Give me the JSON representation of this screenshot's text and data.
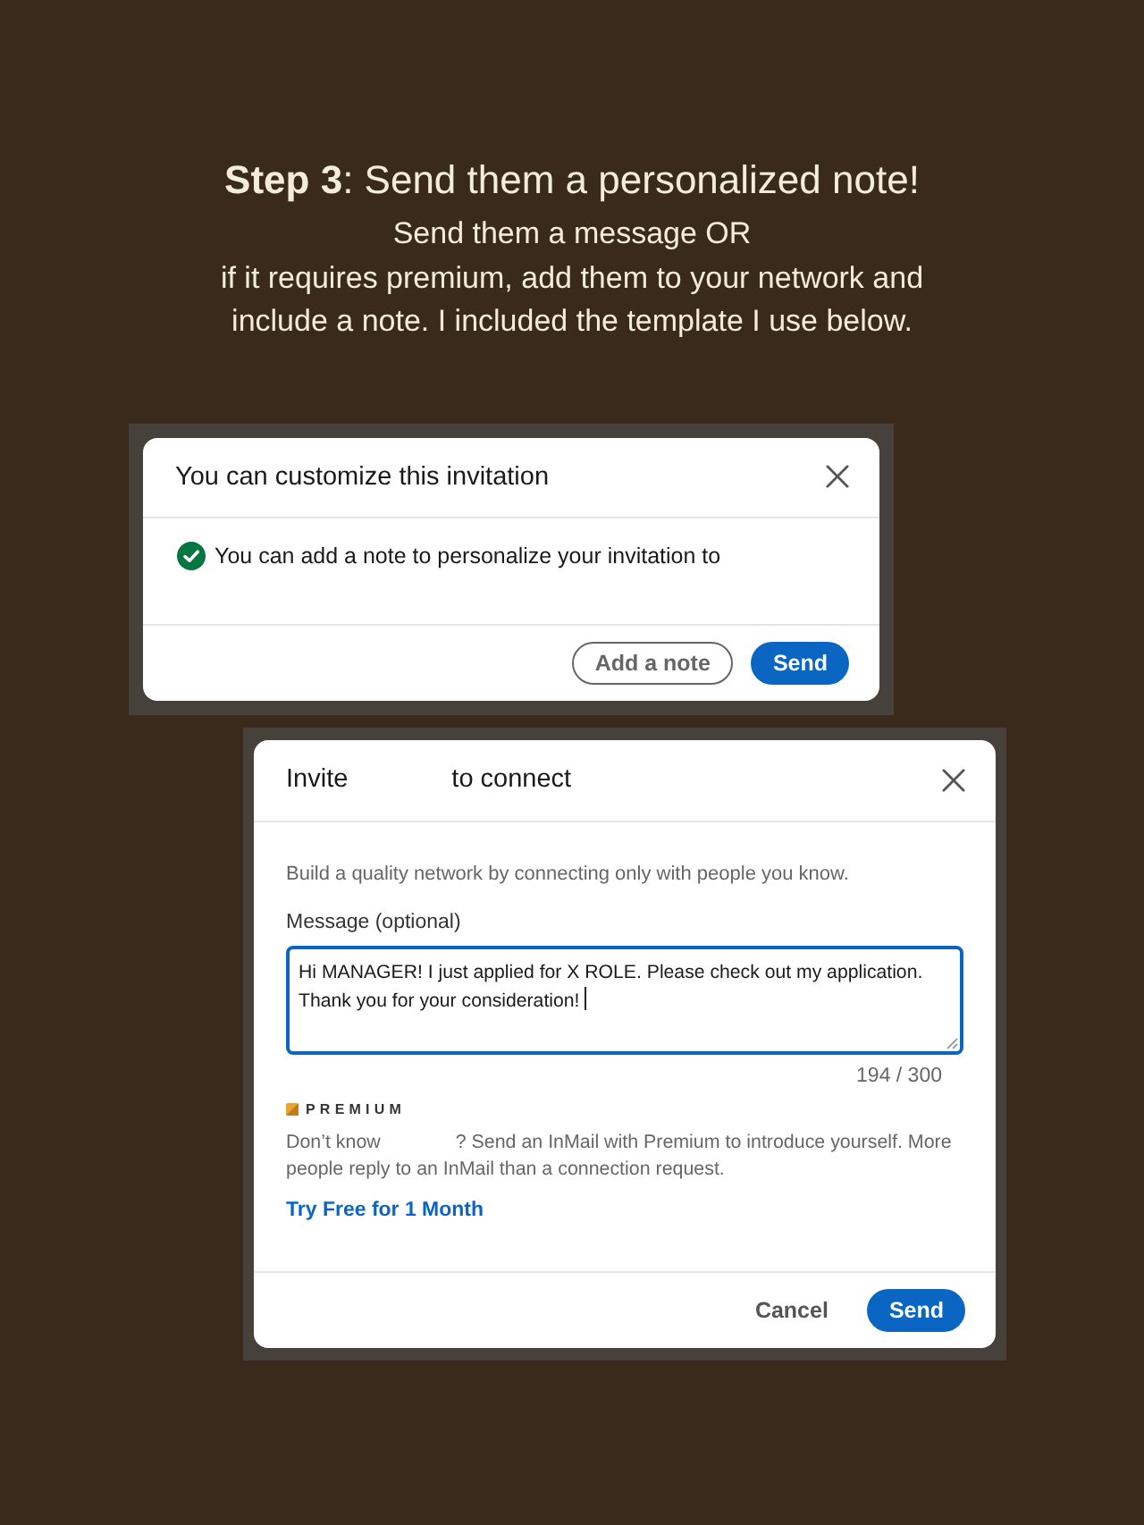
{
  "header": {
    "title": "**Step 3**: Send them a personalized note!",
    "subtitle_lines": [
      "Send them a message OR",
      "if it requires premium, add them to your network and",
      "include a note. I included the template I use below."
    ]
  },
  "invitation_dialog": {
    "title": "You can customize this invitation",
    "notice": "You can add a note to personalize your invitation to",
    "buttons": [
      {
        "label": "Add a note",
        "kind": "secondary"
      },
      {
        "label": "Send",
        "kind": "primary"
      }
    ]
  },
  "connect_dialog": {
    "title_parts": [
      "Invite",
      "to connect"
    ],
    "intro": "Build a quality network by connecting only with people you know.",
    "message_label": "Message (optional)",
    "message": {
      "value": "Hi MANAGER! I just applied for X ROLE. Please check out my application. Thank you for your consideration!",
      "focused": true
    },
    "counter": "194 / 300",
    "premium_label": "PREMIUM",
    "premium_text": [
      "Don’t know",
      "? Send an InMail with Premium to introduce yourself. More people reply to an InMail than a connection request."
    ],
    "premium_link": "Try Free for 1 Month",
    "buttons": [
      {
        "label": "Cancel",
        "kind": "tertiary"
      },
      {
        "label": "Send",
        "kind": "primary"
      }
    ]
  }
}
